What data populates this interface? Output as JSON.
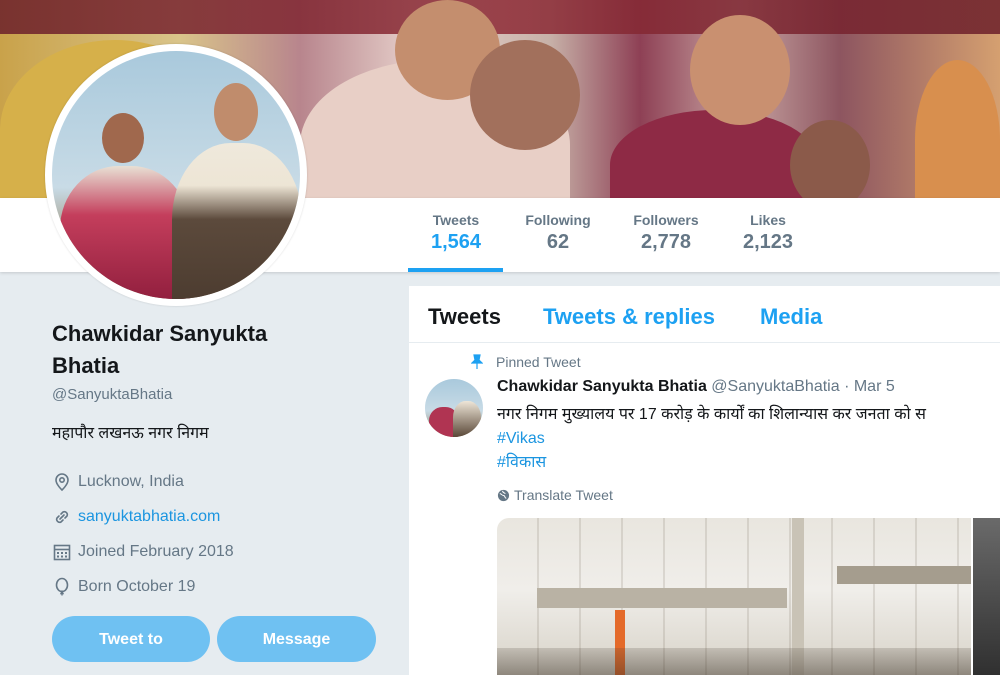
{
  "stats": [
    {
      "label": "Tweets",
      "value": "1,564"
    },
    {
      "label": "Following",
      "value": "62"
    },
    {
      "label": "Followers",
      "value": "2,778"
    },
    {
      "label": "Likes",
      "value": "2,123"
    }
  ],
  "profile": {
    "name_line1": "Chawkidar Sanyukta",
    "name_line2": "Bhatia",
    "handle": "@SanyuktaBhatia",
    "bio": "महापौर लखनऊ नगर निगम",
    "location": "Lucknow, India",
    "website": "sanyuktabhatia.com",
    "joined": "Joined February 2018",
    "born": "Born October 19"
  },
  "buttons": {
    "tweet_to": "Tweet to",
    "message": "Message"
  },
  "tabs": [
    "Tweets",
    "Tweets & replies",
    "Media"
  ],
  "tweet": {
    "pinned_label": "Pinned Tweet",
    "author": "Chawkidar Sanyukta Bhatia",
    "handle": "@SanyuktaBhatia",
    "date": "· Mar 5",
    "text": "नगर निगम मुख्यालय पर 17 करोड़ के कार्यों का शिलान्यास कर जनता को स",
    "hashtags": [
      "#Vikas",
      "#विकास"
    ],
    "translate_label": "Translate Tweet"
  },
  "icons": [
    "location-icon",
    "link-icon",
    "calendar-icon",
    "balloon-icon",
    "pin-icon",
    "globe-icon"
  ],
  "colors": {
    "accent": "#1da1f2",
    "button": "#6fc1f2",
    "muted": "#657786"
  }
}
